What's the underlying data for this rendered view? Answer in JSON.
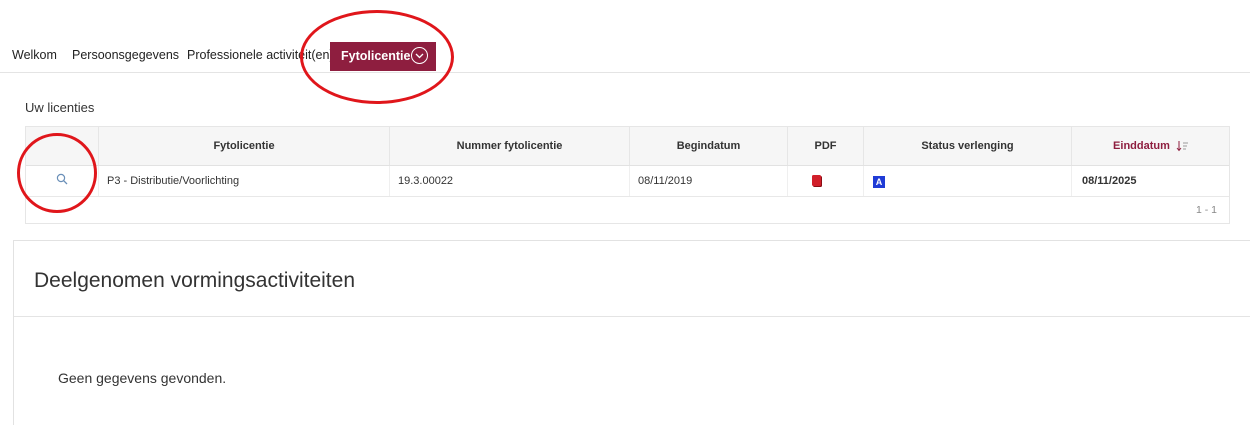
{
  "tabs": [
    {
      "label": "Welkom"
    },
    {
      "label": "Persoonsgegevens"
    },
    {
      "label": "Professionele activiteit(en)"
    },
    {
      "label": "Fytolicentie",
      "active": true
    }
  ],
  "licenses": {
    "section_label": "Uw licenties",
    "columns": [
      "",
      "Fytolicentie",
      "Nummer fytolicentie",
      "Begindatum",
      "PDF",
      "Status verlenging",
      "Einddatum"
    ],
    "sort_column": "Einddatum",
    "rows": [
      {
        "fytolicentie": "P3 - Distributie/Voorlichting",
        "nummer": "19.3.00022",
        "begindatum": "08/11/2019",
        "pdf_icon": "pdf-icon",
        "status_badge": "A",
        "einddatum": "08/11/2025"
      }
    ],
    "pagination": "1 - 1"
  },
  "training": {
    "title": "Deelgenomen vormingsactiviteiten",
    "empty_message": "Geen gegevens gevonden."
  },
  "colors": {
    "accent": "#8e1e3f",
    "annotation": "#e0161b",
    "status_badge": "#1f3bd6"
  }
}
